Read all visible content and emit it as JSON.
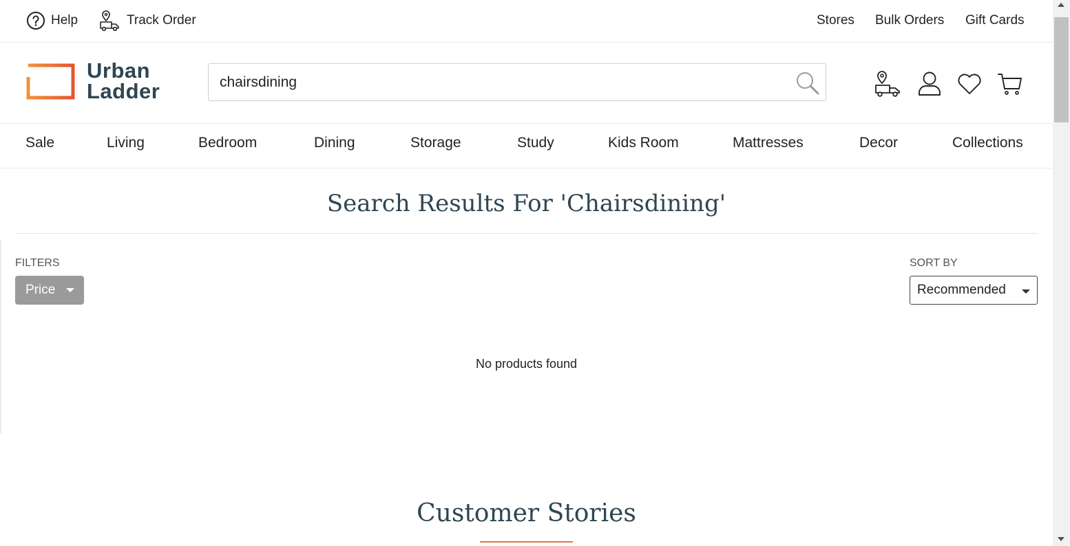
{
  "topbar": {
    "help": "Help",
    "track_order": "Track Order",
    "stores": "Stores",
    "bulk_orders": "Bulk Orders",
    "gift_cards": "Gift Cards"
  },
  "header": {
    "logo_line1": "Urban",
    "logo_line2": "Ladder",
    "search_value": "chairsdining",
    "icons": [
      "store-locator-truck-icon",
      "user-icon",
      "wishlist-heart-icon",
      "cart-icon"
    ]
  },
  "nav": {
    "items": [
      "Sale",
      "Living",
      "Bedroom",
      "Dining",
      "Storage",
      "Study",
      "Kids Room",
      "Mattresses",
      "Decor",
      "Collections"
    ]
  },
  "main": {
    "title": "Search Results For 'Chairsdining'",
    "filters_label": "FILTERS",
    "price_button": "Price",
    "sort_label": "SORT BY",
    "sort_value": "Recommended",
    "empty_message": "No products found",
    "stories_title": "Customer Stories"
  },
  "colors": {
    "brand_dark": "#2f4552",
    "brand_orange": "#e8704a",
    "filter_button": "#9a9a9a"
  }
}
